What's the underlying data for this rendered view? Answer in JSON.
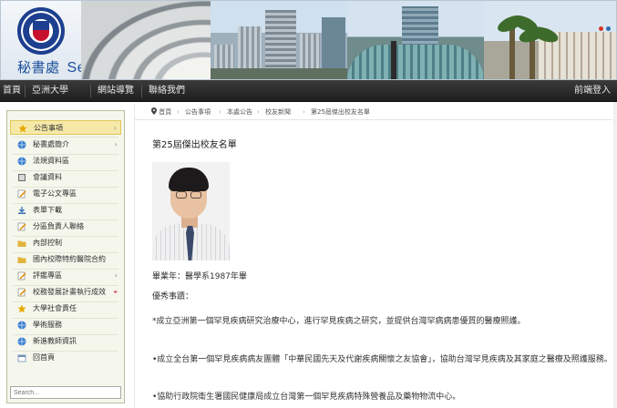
{
  "header": {
    "title_zh": "秘書處",
    "title_en": "Secretariat"
  },
  "nav": {
    "items": [
      "首頁",
      "亞洲大學",
      "網站導覽",
      "聯絡我們"
    ],
    "right": "前端登入"
  },
  "sidebar": {
    "items": [
      {
        "label": "公告事項",
        "icon": "star-icon",
        "arrow": true
      },
      {
        "label": "秘書處簡介",
        "icon": "globe-icon",
        "arrow": true
      },
      {
        "label": "法規資料區",
        "icon": "globe-icon",
        "arrow": false
      },
      {
        "label": "會議資料",
        "icon": "book-icon",
        "arrow": false
      },
      {
        "label": "電子公文專區",
        "icon": "edit-icon",
        "arrow": false
      },
      {
        "label": "表單下載",
        "icon": "download-icon",
        "arrow": false
      },
      {
        "label": "分區負責人聯絡",
        "icon": "edit-icon",
        "arrow": false
      },
      {
        "label": "內部控制",
        "icon": "folder-icon",
        "arrow": false
      },
      {
        "label": "國內校際特約醫院合約",
        "icon": "folder-icon",
        "arrow": false
      },
      {
        "label": "評鑑專區",
        "icon": "edit-icon",
        "arrow": true
      },
      {
        "label": "校務發展計畫執行成效",
        "icon": "edit-icon",
        "arrow": false
      },
      {
        "label": "大學社會責任",
        "icon": "star-icon",
        "arrow": false
      },
      {
        "label": "學術服務",
        "icon": "globe-icon",
        "arrow": false
      },
      {
        "label": "新進教師資訊",
        "icon": "globe-icon",
        "arrow": false
      },
      {
        "label": "回首頁",
        "icon": "home-icon",
        "arrow": false
      }
    ],
    "search_placeholder": "Search..."
  },
  "breadcrumb": [
    "首頁",
    "公告事項",
    "本處公告",
    "校友新聞",
    "第25屆傑出校友名單"
  ],
  "article": {
    "title": "第25屆傑出校友名單",
    "grad_year": "畢業年：醫學系1987年畢",
    "achievements_label": "優秀事蹟：",
    "paragraphs": [
      "*成立亞洲第一個罕見疾病研究治療中心，進行罕見疾病之研究，並提供台灣罕病病患優質的醫療照護。",
      "•成立全台第一個罕見疾病病友團體「中華民國先天及代謝疾病關懷之友協會」，協助台灣罕見疾病及其家庭之醫療及照護服務。",
      "•協助行政院衛生署國民健康局成立台灣第一個罕見疾病特殊營養品及藥物物流中心。"
    ]
  },
  "colors": {
    "nav_bg": "#2a2a2a",
    "sidebar_bg": "#f5f7ec",
    "active_bg": "#f6e9a8",
    "title_blue": "#1b4f9c"
  }
}
